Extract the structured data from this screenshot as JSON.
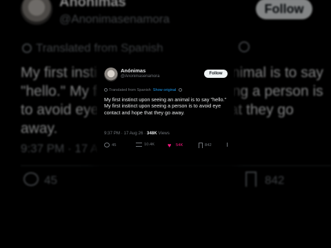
{
  "background": {
    "display_name": "Anónimas",
    "handle": "@Anonimasenamora",
    "follow_label": "Follow",
    "translated_label": "Translated from Spanish",
    "body": "My first instinct upon seeing an animal is to say \"hello.\" My first instinct upon seeing a person is to avoid eye contact and hope that they go away.",
    "time": "9:37 PM · 17 Aug 26",
    "reply_count": "45",
    "bookmark_count": "842"
  },
  "card": {
    "display_name": "Anónimas",
    "handle": "@Anonimasenamora",
    "follow_label": "Follow",
    "translated_label": "Translated from Spanish",
    "show_original": "Show original",
    "body": "My first instinct upon seeing an animal is to say \"hello.\" My first instinct upon seeing a person is to avoid eye contact and hope that they go away.",
    "timestamp": "9:37 PM · 17 Aug 26 · ",
    "views_count": "348K",
    "views_label": " Views",
    "reply_count": "45",
    "retweet_count": "10.4K",
    "like_count": "54K",
    "bookmark_count": "842",
    "like_color": "#f91880",
    "link_color": "#1d9bf0"
  }
}
